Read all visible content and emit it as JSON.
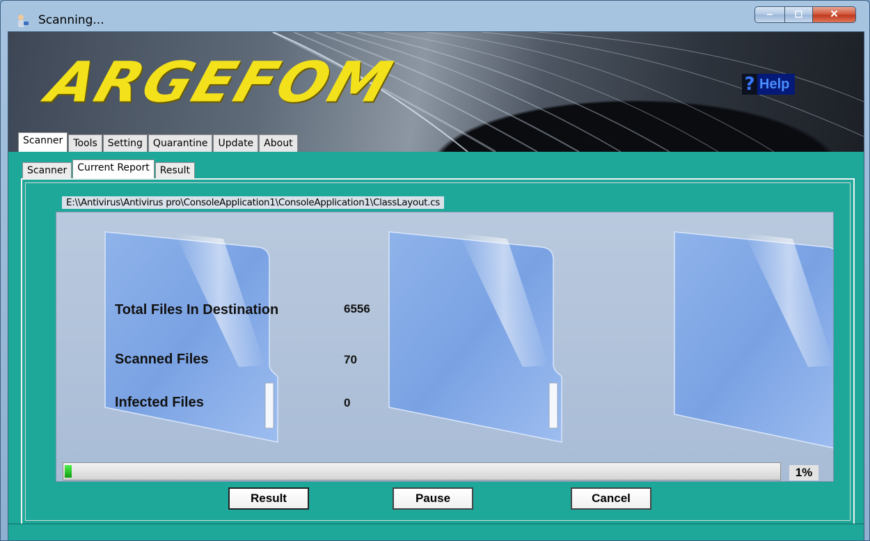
{
  "window": {
    "title": "Scanning...",
    "minimize_glyph": "‒",
    "maximize_glyph": "☐",
    "close_glyph": "✕"
  },
  "banner": {
    "logo_text": "ARGEFOM",
    "help_symbol": "?",
    "help_label": "Help"
  },
  "top_tabs": [
    {
      "label": "Scanner",
      "active": true
    },
    {
      "label": "Tools"
    },
    {
      "label": "Setting"
    },
    {
      "label": "Quarantine"
    },
    {
      "label": "Update"
    },
    {
      "label": "About"
    }
  ],
  "sub_tabs": [
    {
      "label": "Scanner"
    },
    {
      "label": "Current Report",
      "active": true
    },
    {
      "label": "Result"
    }
  ],
  "report": {
    "current_path": "E:\\\\Antivirus\\Antivirus pro\\ConsoleApplication1\\ConsoleApplication1\\ClassLayout.cs",
    "total_files_label": "Total Files In Destination",
    "total_files_value": "6556",
    "scanned_files_label": "Scanned Files",
    "scanned_files_value": "70",
    "infected_files_label": "Infected Files",
    "infected_files_value": "0",
    "progress_fraction": 0.01,
    "progress_text": "1%"
  },
  "buttons": {
    "result": "Result",
    "pause": "Pause",
    "cancel": "Cancel"
  },
  "colors": {
    "background_teal": "#1ea89a",
    "logo_yellow": "#f3e21b",
    "progress_green": "#22c025",
    "help_blue": "#4a8dff"
  }
}
